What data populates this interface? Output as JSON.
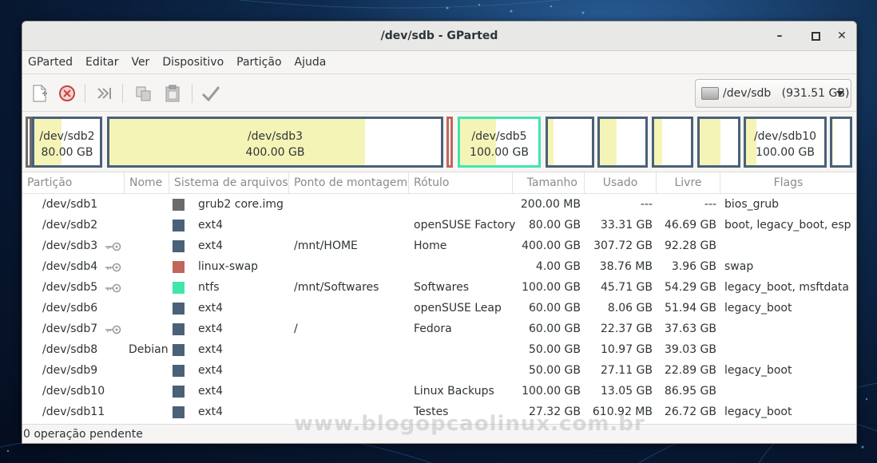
{
  "window": {
    "title": "/dev/sdb - GParted"
  },
  "menu": [
    "GParted",
    "Editar",
    "Ver",
    "Dispositivo",
    "Partição",
    "Ajuda"
  ],
  "device_selector": {
    "label": "/dev/sdb   (931.51 GB)"
  },
  "map": {
    "partitions": [
      {
        "name": "/dev/sdb2",
        "size": "80.00 GB"
      },
      {
        "name": "/dev/sdb3",
        "size": "400.00 GB"
      },
      {
        "name": "/dev/sdb5",
        "size": "100.00 GB"
      },
      {
        "name": "/dev/sdb10",
        "size": "100.00 GB"
      }
    ]
  },
  "table": {
    "headers": [
      "Partição",
      "Nome",
      "Sistema de arquivos",
      "Ponto de montagem",
      "Rótulo",
      "Tamanho",
      "Usado",
      "Livre",
      "Flags"
    ],
    "rows": [
      {
        "partition": "/dev/sdb1",
        "name": "",
        "fs": "grub2 core.img",
        "mount": "",
        "label": "",
        "size": "200.00 MB",
        "used": "---",
        "free": "---",
        "flags": "bios_grub",
        "key": false,
        "color": "#6b6b6b"
      },
      {
        "partition": "/dev/sdb2",
        "name": "",
        "fs": "ext4",
        "mount": "",
        "label": "openSUSE Factory",
        "size": "80.00 GB",
        "used": "33.31 GB",
        "free": "46.69 GB",
        "flags": "boot, legacy_boot, esp",
        "key": false,
        "color": "#4a6177"
      },
      {
        "partition": "/dev/sdb3",
        "name": "",
        "fs": "ext4",
        "mount": "/mnt/HOME",
        "label": "Home",
        "size": "400.00 GB",
        "used": "307.72 GB",
        "free": "92.28 GB",
        "flags": "",
        "key": true,
        "color": "#4a6177"
      },
      {
        "partition": "/dev/sdb4",
        "name": "",
        "fs": "linux-swap",
        "mount": "",
        "label": "",
        "size": "4.00 GB",
        "used": "38.76 MB",
        "free": "3.96 GB",
        "flags": "swap",
        "key": true,
        "color": "#c1665a"
      },
      {
        "partition": "/dev/sdb5",
        "name": "",
        "fs": "ntfs",
        "mount": "/mnt/Softwares",
        "label": "Softwares",
        "size": "100.00 GB",
        "used": "45.71 GB",
        "free": "54.29 GB",
        "flags": "legacy_boot, msftdata",
        "key": true,
        "color": "#42e5ac"
      },
      {
        "partition": "/dev/sdb6",
        "name": "",
        "fs": "ext4",
        "mount": "",
        "label": "openSUSE Leap",
        "size": "60.00 GB",
        "used": "8.06 GB",
        "free": "51.94 GB",
        "flags": "legacy_boot",
        "key": false,
        "color": "#4a6177"
      },
      {
        "partition": "/dev/sdb7",
        "name": "",
        "fs": "ext4",
        "mount": "/",
        "label": "Fedora",
        "size": "60.00 GB",
        "used": "22.37 GB",
        "free": "37.63 GB",
        "flags": "",
        "key": true,
        "color": "#4a6177"
      },
      {
        "partition": "/dev/sdb8",
        "name": "Debian",
        "fs": "ext4",
        "mount": "",
        "label": "",
        "size": "50.00 GB",
        "used": "10.97 GB",
        "free": "39.03 GB",
        "flags": "",
        "key": false,
        "color": "#4a6177"
      },
      {
        "partition": "/dev/sdb9",
        "name": "",
        "fs": "ext4",
        "mount": "",
        "label": "",
        "size": "50.00 GB",
        "used": "27.11 GB",
        "free": "22.89 GB",
        "flags": "legacy_boot",
        "key": false,
        "color": "#4a6177"
      },
      {
        "partition": "/dev/sdb10",
        "name": "",
        "fs": "ext4",
        "mount": "",
        "label": "Linux Backups",
        "size": "100.00 GB",
        "used": "13.05 GB",
        "free": "86.95 GB",
        "flags": "",
        "key": false,
        "color": "#4a6177"
      },
      {
        "partition": "/dev/sdb11",
        "name": "",
        "fs": "ext4",
        "mount": "",
        "label": "Testes",
        "size": "27.32 GB",
        "used": "610.92 MB",
        "free": "26.72 GB",
        "flags": "legacy_boot",
        "key": false,
        "color": "#4a6177"
      }
    ]
  },
  "status": {
    "text": "0 operação pendente"
  },
  "watermark": "www.blogopcaolinux.com.br",
  "colors": {
    "ext4": "#4a6177",
    "ntfs": "#42e5ac",
    "linux_swap": "#c1665a",
    "grub": "#6b6b6b",
    "used_fill": "#f5f4b7"
  }
}
